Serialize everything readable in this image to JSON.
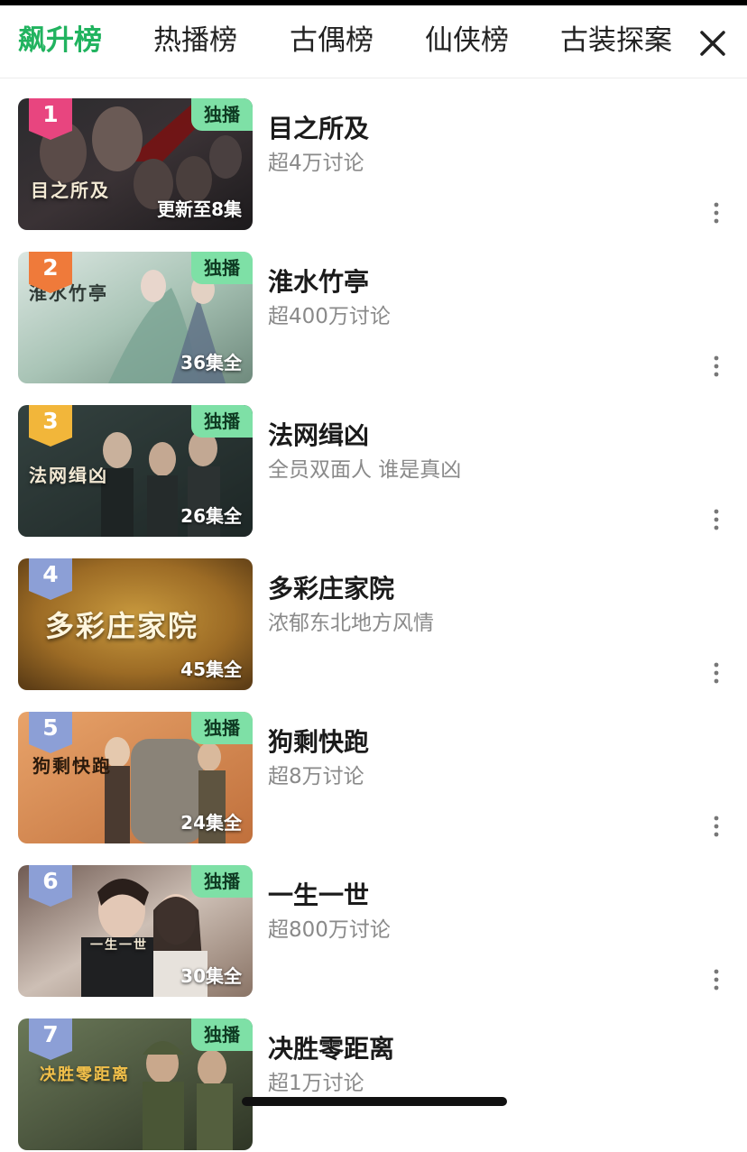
{
  "tabs": [
    {
      "label": "飙升榜",
      "active": true
    },
    {
      "label": "热播榜",
      "active": false
    },
    {
      "label": "古偶榜",
      "active": false
    },
    {
      "label": "仙侠榜",
      "active": false
    },
    {
      "label": "古装探案",
      "active": false
    }
  ],
  "close_icon": "close-icon",
  "items": [
    {
      "rank": "1",
      "title": "目之所及",
      "subtitle": "超4万讨论",
      "episodes": "更新至8集",
      "exclusive": "独播",
      "poster_text": "目之所及",
      "badge_color": "#e8457f"
    },
    {
      "rank": "2",
      "title": "淮水竹亭",
      "subtitle": "超400万讨论",
      "episodes": "36集全",
      "exclusive": "独播",
      "poster_text": "淮水竹亭",
      "badge_color": "#ef7a3a"
    },
    {
      "rank": "3",
      "title": "法网缉凶",
      "subtitle": "全员双面人 谁是真凶",
      "episodes": "26集全",
      "exclusive": "独播",
      "poster_text": "法网缉凶",
      "badge_color": "#f2b63a"
    },
    {
      "rank": "4",
      "title": "多彩庄家院",
      "subtitle": "浓郁东北地方风情",
      "episodes": "45集全",
      "exclusive": "",
      "poster_text": "多彩庄家院",
      "badge_color": "#8c9fd6"
    },
    {
      "rank": "5",
      "title": "狗剩快跑",
      "subtitle": "超8万讨论",
      "episodes": "24集全",
      "exclusive": "独播",
      "poster_text": "狗剩快跑",
      "badge_color": "#8c9fd6"
    },
    {
      "rank": "6",
      "title": "一生一世",
      "subtitle": "超800万讨论",
      "episodes": "30集全",
      "exclusive": "独播",
      "poster_text": "一生一世",
      "badge_color": "#8c9fd6"
    },
    {
      "rank": "7",
      "title": "决胜零距离",
      "subtitle": "超1万讨论",
      "episodes": "",
      "exclusive": "独播",
      "poster_text": "决胜零距离",
      "badge_color": "#8c9fd6"
    }
  ],
  "colors": {
    "accent": "#21b35f",
    "exclusive_bg": "#7ee0a6"
  }
}
